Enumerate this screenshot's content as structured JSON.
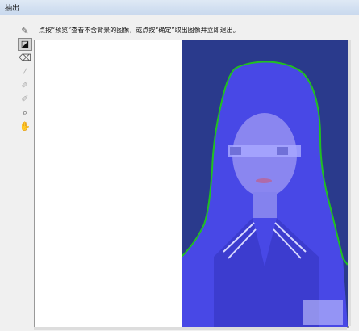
{
  "window": {
    "title": "抽出"
  },
  "instruction": "点按“预览”查看不含背景的图像，或点按“确定”取出图像并立即退出。",
  "tools": [
    {
      "name": "edge-highlighter-tool",
      "icon": "✎",
      "state": "normal"
    },
    {
      "name": "fill-tool",
      "icon": "◪",
      "state": "active"
    },
    {
      "name": "eraser-tool",
      "icon": "⌫",
      "state": "normal"
    },
    {
      "name": "eyedropper-tool",
      "icon": "⁄",
      "state": "dim"
    },
    {
      "name": "cleanup-tool",
      "icon": "✐",
      "state": "dim"
    },
    {
      "name": "edge-touchup-tool",
      "icon": "✐",
      "state": "dim"
    },
    {
      "name": "zoom-tool",
      "icon": "⌕",
      "state": "normal"
    },
    {
      "name": "hand-tool",
      "icon": "✋",
      "state": "normal"
    }
  ],
  "colors": {
    "background": "#2a3a8c",
    "fill": "#4848e6",
    "skin_tint": "#8a86f0",
    "outline": "#20c020",
    "face_blur": "#a7a7ff"
  }
}
